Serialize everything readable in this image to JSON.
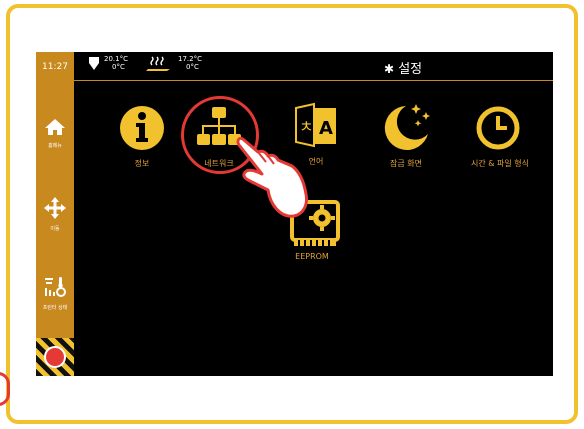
{
  "status": {
    "time": "11:27",
    "hotend": {
      "current": "20.1°C",
      "target": "0°C"
    },
    "bed": {
      "current": "17.2°C",
      "target": "0°C"
    }
  },
  "header": {
    "title": "설정"
  },
  "sidebar": {
    "items": [
      {
        "label": "홈메뉴",
        "icon": "home-icon"
      },
      {
        "label": "이동",
        "icon": "move-arrows-icon"
      },
      {
        "label": "프린터 상태",
        "icon": "printer-status-icon"
      }
    ]
  },
  "grid": {
    "items": [
      {
        "label": "정보",
        "icon": "info-icon"
      },
      {
        "label": "네트워크",
        "icon": "network-icon"
      },
      {
        "label": "언어",
        "icon": "language-icon"
      },
      {
        "label": "잠금 화면",
        "icon": "moon-stars-icon"
      },
      {
        "label": "시간 & 파일 형식",
        "icon": "clock-icon"
      },
      {
        "label": "EEPROM",
        "icon": "chip-gear-icon"
      }
    ]
  },
  "colors": {
    "accent": "#f2c12e",
    "sidebar": "#c8891e",
    "highlight": "#e53935"
  }
}
